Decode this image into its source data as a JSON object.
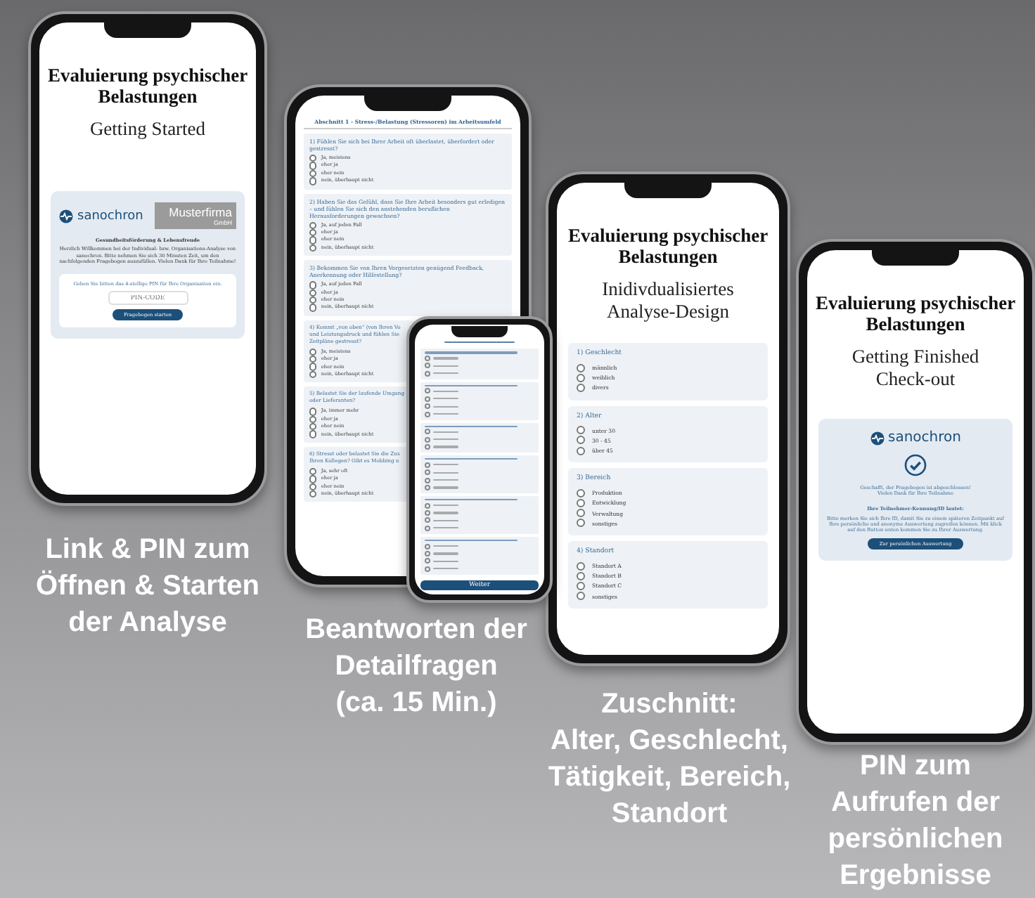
{
  "phone_start": {
    "title": [
      "Evaluierung psychischer",
      "Belastungen"
    ],
    "subtitle": [
      "Getting Started"
    ],
    "brand": "sanochron",
    "partner": {
      "name": "Musterfirma",
      "suffix": "GmbH"
    },
    "intro_heading": "Gesundheitsförderung & Lebensfreude",
    "intro": "Herzlich Willkommen bei der Individual- bzw. Organisations-Analyse von sanochron. Bitte nehmen Sie sich 30 Minuten Zeit, um den nachfolgenden Fragebogen auszufüllen. Vielen Dank für Ihre Teilnahme!",
    "pin_prompt": "Geben Sie bitten das 4-stellige PIN für Ihre Organisation ein.",
    "pin_placeholder": "PIN-CODE",
    "button": "Fragebogen starten"
  },
  "phone_questions": {
    "heading": "Abschnitt 1 - Stress-/Belastung (Stressoren) im Arbeitsumfeld",
    "questions": [
      {
        "text": "1) Fühlen Sie sich bei Ihrer Arbeit oft überlastet, überfordert oder gestresst?",
        "options": [
          {
            "label": "Ja, meistens",
            "selected": false
          },
          {
            "label": "eher ja",
            "selected": false
          },
          {
            "label": "eher nein",
            "selected": false
          },
          {
            "label": "nein, überhaupt nicht",
            "selected": false
          }
        ]
      },
      {
        "text": "2) Haben Sie das Gefühl, dass Sie Ihre Arbeit besonders gut erledigen – und fühlen Sie sich den anstehenden beruflichen Herausforderungen gewachsen?",
        "options": [
          {
            "label": "Ja, auf jeden Fall",
            "selected": false
          },
          {
            "label": "eher ja",
            "selected": false
          },
          {
            "label": "eher nein",
            "selected": false
          },
          {
            "label": "nein, überhaupt nicht",
            "selected": false
          }
        ]
      },
      {
        "text": "3) Bekommen Sie von Ihren Vorgesetzten genügend Feedback, Anerkennung oder Hilfestellung?",
        "options": [
          {
            "label": "Ja, auf jeden Fall",
            "selected": false
          },
          {
            "label": "eher ja",
            "selected": false
          },
          {
            "label": "eher nein",
            "selected": false
          },
          {
            "label": "nein, überhaupt nicht",
            "selected": false
          }
        ]
      },
      {
        "lines": [
          "4) Kommt „von oben“ (von Ihren Vo",
          "und Leistungsdruck und fühlen Sie",
          "Zeitpläne gestresst?"
        ],
        "options": [
          {
            "label": "Ja, meistens",
            "selected": false
          },
          {
            "label": "eher ja",
            "selected": false
          },
          {
            "label": "eher nein",
            "selected": false
          },
          {
            "label": "nein, überhaupt nicht",
            "selected": false
          }
        ]
      },
      {
        "lines": [
          "5) Belastet Sie der laufende Umgang",
          "oder Lieferanten?"
        ],
        "options": [
          {
            "label": "Ja, immer mehr",
            "selected": false
          },
          {
            "label": "eher ja",
            "selected": false
          },
          {
            "label": "eher nein",
            "selected": false
          },
          {
            "label": "nein, überhaupt nicht",
            "selected": false
          }
        ]
      },
      {
        "lines": [
          "6) Stresst oder belastet Sie die Zus",
          "Ihren Kollegen? Gibt es Mobbing u"
        ],
        "options": [
          {
            "label": "Ja, sehr oft",
            "selected": false
          },
          {
            "label": "eher ja",
            "selected": false
          },
          {
            "label": "eher nein",
            "selected": false
          },
          {
            "label": "nein, überhaupt nicht",
            "selected": false
          }
        ]
      }
    ]
  },
  "phone_small": {
    "questions": [
      {
        "options": [
          {
            "selected": false
          },
          {
            "selected": false
          },
          {
            "selected": false
          }
        ]
      },
      {
        "options": [
          {
            "selected": false
          },
          {
            "selected": false
          },
          {
            "selected": false
          },
          {
            "selected": false
          }
        ]
      },
      {
        "options": [
          {
            "selected": false
          },
          {
            "selected": false
          },
          {
            "selected": false
          }
        ]
      },
      {
        "options": [
          {
            "selected": false
          },
          {
            "selected": false
          },
          {
            "selected": false
          },
          {
            "selected": false
          }
        ]
      },
      {
        "options": [
          {
            "selected": false
          },
          {
            "selected": false
          },
          {
            "selected": false
          },
          {
            "selected": false
          }
        ]
      },
      {
        "options": [
          {
            "selected": false
          },
          {
            "selected": false
          },
          {
            "selected": false
          },
          {
            "selected": false
          }
        ]
      }
    ],
    "button": "Weiter"
  },
  "phone_profile": {
    "title": [
      "Evaluierung psychischer",
      "Belastungen"
    ],
    "subtitle": [
      "Inidivdualisiertes",
      "Analyse-Design"
    ],
    "questions": [
      {
        "text": "1) Geschlecht",
        "options": [
          {
            "label": "männlich",
            "selected": false
          },
          {
            "label": "weiblich",
            "selected": false
          },
          {
            "label": "divers",
            "selected": false
          }
        ]
      },
      {
        "text": "2) Alter",
        "options": [
          {
            "label": "unter 30",
            "selected": false
          },
          {
            "label": "30 - 45",
            "selected": false
          },
          {
            "label": "über 45",
            "selected": false
          }
        ]
      },
      {
        "text": "3) Bereich",
        "options": [
          {
            "label": "Produktion",
            "selected": false
          },
          {
            "label": "Entwicklung",
            "selected": false
          },
          {
            "label": "Verwaltung",
            "selected": false
          },
          {
            "label": "sonstiges",
            "selected": false
          }
        ]
      },
      {
        "text": "4) Standort",
        "options": [
          {
            "label": "Standort A",
            "selected": false
          },
          {
            "label": "Standort B",
            "selected": false
          },
          {
            "label": "Standort C",
            "selected": false
          },
          {
            "label": "sonstiges",
            "selected": false
          }
        ]
      }
    ]
  },
  "phone_finish": {
    "title": [
      "Evaluierung psychischer",
      "Belastungen"
    ],
    "subtitle": [
      "Getting Finished",
      "Check-out"
    ],
    "brand": "sanochron",
    "done": [
      "Geschafft, der Fragebogen ist abgeschlossen!",
      "Vielen Dank für Ihre Teilnahme"
    ],
    "id_label": "Ihre Teilnehmer-Kennung/ID lautet:",
    "info": "Bitte merken Sie sich Ihre ID, damit Sie zu einem späteren Zeitpunkt auf Ihre persönliche und anonyme Auswertung zugreifen können. Mit klick auf den Button unten kommen Sie zu Ihrer Auswertung.",
    "button": "Zur persönlichen Auswertung"
  },
  "captions": [
    {
      "lines": [
        "Link & PIN zum",
        "Öffnen & Starten",
        "der Analyse"
      ]
    },
    {
      "lines": [
        "Beantworten der",
        "Detailfragen",
        "(ca. 15 Min.)"
      ]
    },
    {
      "lines": [
        "Zuschnitt:",
        "Alter, Geschlecht,",
        "Tätigkeit, Bereich,",
        "Standort"
      ]
    },
    {
      "lines": [
        "PIN zum",
        "Aufrufen der",
        "persönlichen",
        "Ergebnisse"
      ]
    }
  ]
}
